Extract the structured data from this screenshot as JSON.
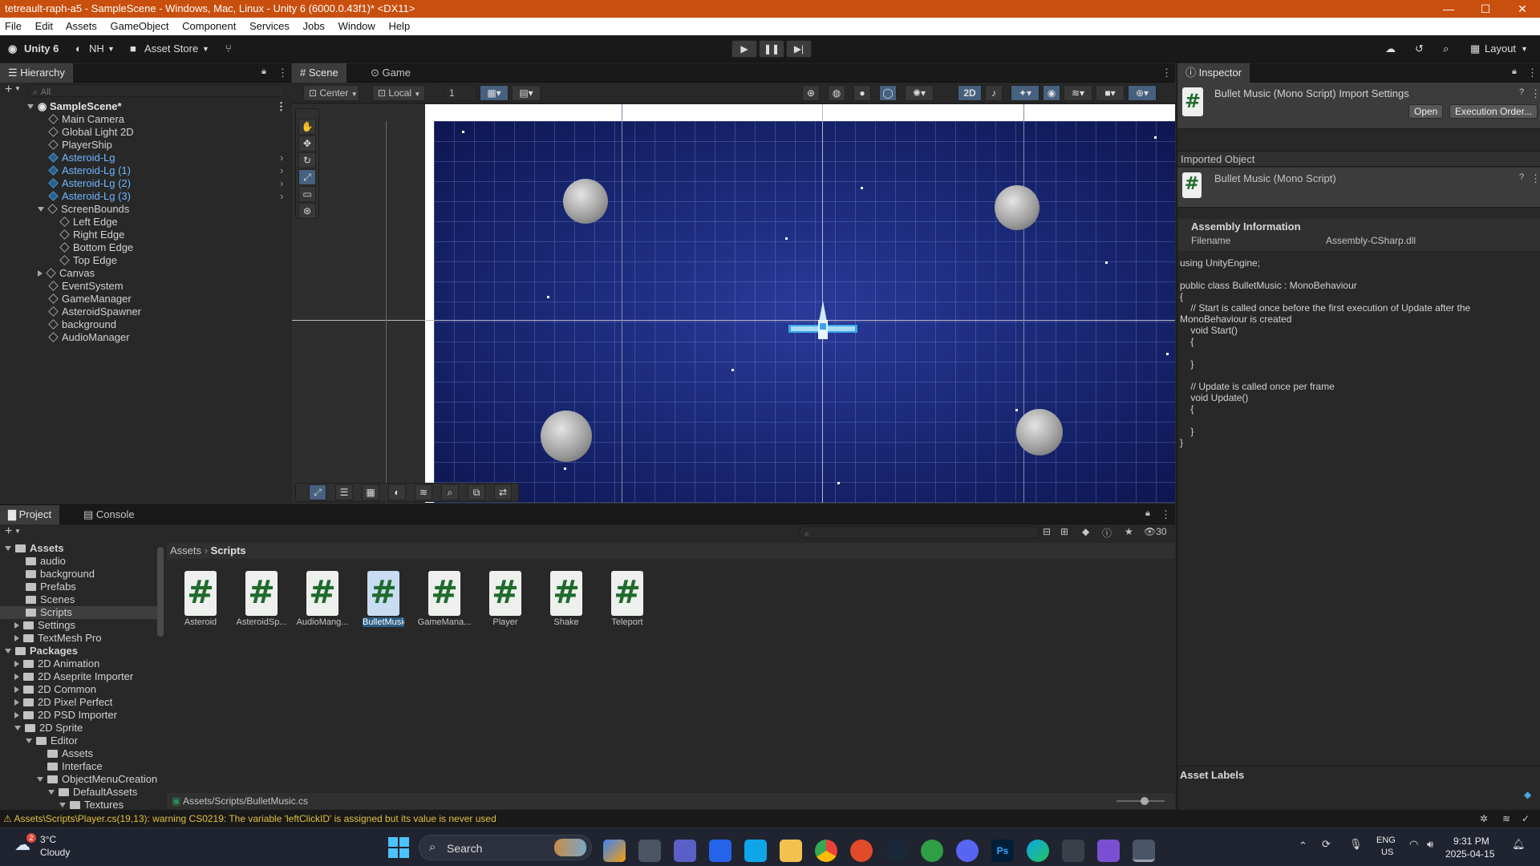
{
  "window": {
    "title": "tetreault-raph-a5 - SampleScene - Windows, Mac, Linux - Unity 6 (6000.0.43f1)* <DX11>"
  },
  "menu": [
    "File",
    "Edit",
    "Assets",
    "GameObject",
    "Component",
    "Services",
    "Jobs",
    "Window",
    "Help"
  ],
  "toolbar": {
    "unity": "Unity 6",
    "account": "NH",
    "asset_store": "Asset Store",
    "layout": "Layout"
  },
  "hierarchy": {
    "title": "Hierarchy",
    "search_placeholder": "All",
    "scene": "SampleScene*",
    "items": [
      "Main Camera",
      "Global Light 2D",
      "PlayerShip",
      "Asteroid-Lg",
      "Asteroid-Lg (1)",
      "Asteroid-Lg (2)",
      "Asteroid-Lg (3)",
      "ScreenBounds",
      "Left Edge",
      "Right Edge",
      "Bottom Edge",
      "Top Edge",
      "Canvas",
      "EventSystem",
      "GameManager",
      "AsteroidSpawner",
      "background",
      "AudioManager"
    ]
  },
  "scene": {
    "tab_scene": "Scene",
    "tab_game": "Game",
    "pivot": "Center",
    "space": "Local",
    "snap": "1",
    "mode2d": "2D"
  },
  "project": {
    "tab_project": "Project",
    "tab_console": "Console",
    "count": "30",
    "breadcrumb_root": "Assets",
    "breadcrumb_current": "Scripts",
    "tree": [
      "Assets",
      "audio",
      "background",
      "Prefabs",
      "Scenes",
      "Scripts",
      "Settings",
      "TextMesh Pro",
      "Packages",
      "2D Animation",
      "2D Aseprite Importer",
      "2D Common",
      "2D Pixel Perfect",
      "2D PSD Importer",
      "2D Sprite",
      "Editor",
      "Assets",
      "Interface",
      "ObjectMenuCreation",
      "DefaultAssets",
      "Textures"
    ],
    "files": [
      "Asteroid",
      "AsteroidSp...",
      "AudioMang...",
      "BulletMusic",
      "GameMana...",
      "Player",
      "Shake",
      "Teleport"
    ],
    "path": "Assets/Scripts/BulletMusic.cs"
  },
  "inspector": {
    "title": "Inspector",
    "header": "Bullet Music (Mono Script) Import Settings",
    "open": "Open",
    "exec_order": "Execution Order...",
    "imported_object": "Imported Object",
    "object_name": "Bullet Music (Mono Script)",
    "assembly_info": "Assembly Information",
    "filename_label": "Filename",
    "filename_value": "Assembly-CSharp.dll",
    "asset_labels": "Asset Labels",
    "code": "using UnityEngine;\n\npublic class BulletMusic : MonoBehaviour\n{\n    // Start is called once before the first execution of Update after the\nMonoBehaviour is created\n    void Start()\n    {\n\n    }\n\n    // Update is called once per frame\n    void Update()\n    {\n\n    }\n}"
  },
  "status": {
    "warning": "Assets\\Scripts\\Player.cs(19,13): warning CS0219: The variable 'leftClickID' is assigned but its value is never used"
  },
  "taskbar": {
    "temp": "3°C",
    "weather": "Cloudy",
    "search": "Search",
    "lang1": "ENG",
    "lang2": "US",
    "time": "9:31 PM",
    "date": "2025-04-15",
    "badge": "2"
  }
}
